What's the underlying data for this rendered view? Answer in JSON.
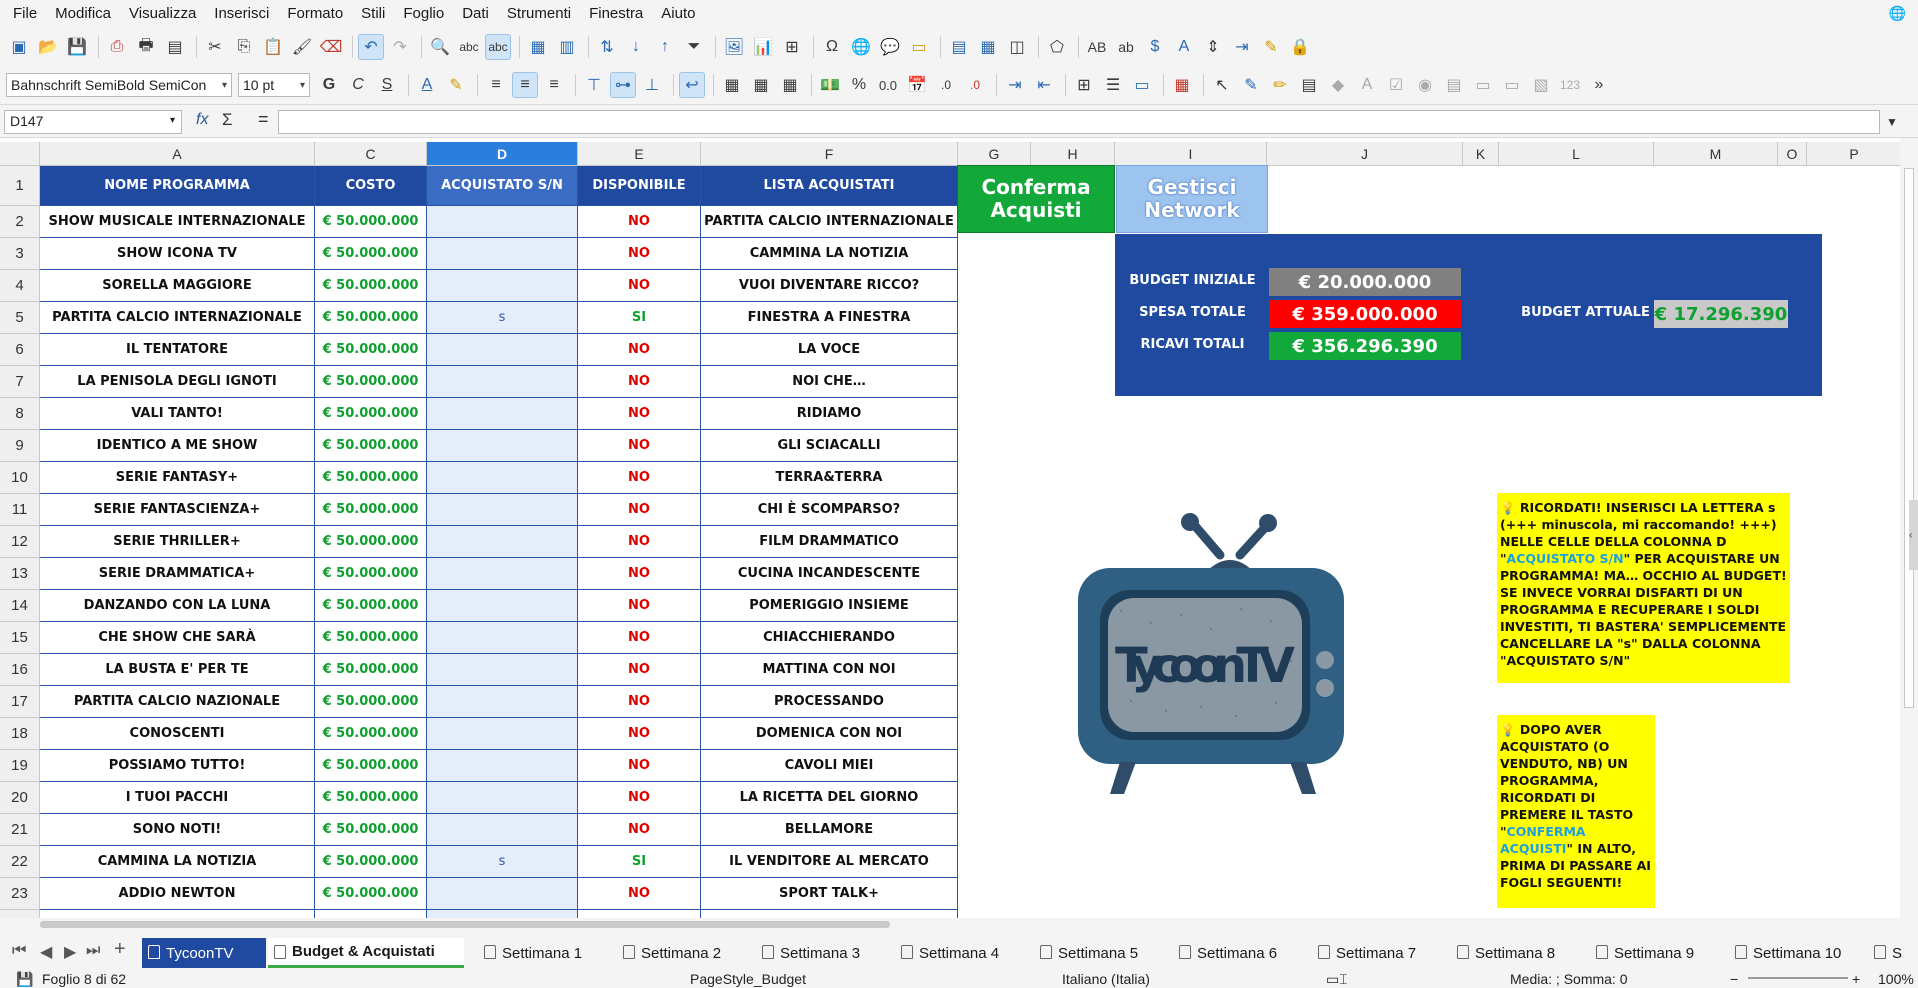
{
  "menubar": {
    "items": [
      "File",
      "Modifica",
      "Visualizza",
      "Inserisci",
      "Formato",
      "Stili",
      "Foglio",
      "Dati",
      "Strumenti",
      "Finestra",
      "Aiuto"
    ]
  },
  "toolbar": {
    "font_name": "Bahnschrift SemiBold SemiCon",
    "font_size": "10 pt",
    "bold": "G",
    "italic": "C",
    "underline": "S",
    "percent": "%",
    "decimal": "0.0"
  },
  "formula_bar": {
    "cell_ref": "D147",
    "fx": "fx",
    "sigma": "Σ",
    "equals": "=",
    "content": ""
  },
  "columns": [
    {
      "label": "A",
      "selected": false
    },
    {
      "label": "C",
      "selected": false
    },
    {
      "label": "D",
      "selected": true
    },
    {
      "label": "E",
      "selected": false
    },
    {
      "label": "F",
      "selected": false
    },
    {
      "label": "G",
      "selected": false
    },
    {
      "label": "H",
      "selected": false
    },
    {
      "label": "I",
      "selected": false
    },
    {
      "label": "J",
      "selected": false
    },
    {
      "label": "K",
      "selected": false
    },
    {
      "label": "L",
      "selected": false
    },
    {
      "label": "M",
      "selected": false
    },
    {
      "label": "O",
      "selected": false
    },
    {
      "label": "P",
      "selected": false
    }
  ],
  "table": {
    "headers": [
      "NOME PROGRAMMA",
      "COSTO",
      "ACQUISTATO S/N",
      "DISPONIBILE",
      "LISTA ACQUISTATI"
    ],
    "rows": [
      {
        "n": "2",
        "nome": "SHOW MUSICALE INTERNAZIONALE",
        "costo": "€ 50.000.000",
        "acq": "",
        "disp": "NO",
        "lista": "PARTITA CALCIO INTERNAZIONALE"
      },
      {
        "n": "3",
        "nome": "SHOW ICONA TV",
        "costo": "€ 50.000.000",
        "acq": "",
        "disp": "NO",
        "lista": "CAMMINA LA NOTIZIA"
      },
      {
        "n": "4",
        "nome": "SORELLA MAGGIORE",
        "costo": "€ 50.000.000",
        "acq": "",
        "disp": "NO",
        "lista": "VUOI DIVENTARE RICCO?"
      },
      {
        "n": "5",
        "nome": "PARTITA CALCIO INTERNAZIONALE",
        "costo": "€ 50.000.000",
        "acq": "s",
        "disp": "SI",
        "lista": "FINESTRA A FINESTRA"
      },
      {
        "n": "6",
        "nome": "IL TENTATORE",
        "costo": "€ 50.000.000",
        "acq": "",
        "disp": "NO",
        "lista": "LA VOCE"
      },
      {
        "n": "7",
        "nome": "LA PENISOLA DEGLI IGNOTI",
        "costo": "€ 50.000.000",
        "acq": "",
        "disp": "NO",
        "lista": "NOI CHE…"
      },
      {
        "n": "8",
        "nome": "VALI TANTO!",
        "costo": "€ 50.000.000",
        "acq": "",
        "disp": "NO",
        "lista": "RIDIAMO"
      },
      {
        "n": "9",
        "nome": "IDENTICO A ME SHOW",
        "costo": "€ 50.000.000",
        "acq": "",
        "disp": "NO",
        "lista": "GLI SCIACALLI"
      },
      {
        "n": "10",
        "nome": "SERIE FANTASY+",
        "costo": "€ 50.000.000",
        "acq": "",
        "disp": "NO",
        "lista": "TERRA&TERRA"
      },
      {
        "n": "11",
        "nome": "SERIE FANTASCIENZA+",
        "costo": "€ 50.000.000",
        "acq": "",
        "disp": "NO",
        "lista": "CHI È SCOMPARSO?"
      },
      {
        "n": "12",
        "nome": "SERIE THRILLER+",
        "costo": "€ 50.000.000",
        "acq": "",
        "disp": "NO",
        "lista": "FILM DRAMMATICO"
      },
      {
        "n": "13",
        "nome": "SERIE DRAMMATICA+",
        "costo": "€ 50.000.000",
        "acq": "",
        "disp": "NO",
        "lista": "CUCINA INCANDESCENTE"
      },
      {
        "n": "14",
        "nome": "DANZANDO CON LA LUNA",
        "costo": "€ 50.000.000",
        "acq": "",
        "disp": "NO",
        "lista": "POMERIGGIO INSIEME"
      },
      {
        "n": "15",
        "nome": "CHE SHOW CHE SARÀ",
        "costo": "€ 50.000.000",
        "acq": "",
        "disp": "NO",
        "lista": "CHIACCHIERANDO"
      },
      {
        "n": "16",
        "nome": "LA BUSTA E' PER TE",
        "costo": "€ 50.000.000",
        "acq": "",
        "disp": "NO",
        "lista": "MATTINA CON NOI"
      },
      {
        "n": "17",
        "nome": "PARTITA CALCIO NAZIONALE",
        "costo": "€ 50.000.000",
        "acq": "",
        "disp": "NO",
        "lista": "PROCESSANDO"
      },
      {
        "n": "18",
        "nome": "CONOSCENTI",
        "costo": "€ 50.000.000",
        "acq": "",
        "disp": "NO",
        "lista": "DOMENICA CON NOI"
      },
      {
        "n": "19",
        "nome": "POSSIAMO TUTTO!",
        "costo": "€ 50.000.000",
        "acq": "",
        "disp": "NO",
        "lista": "CAVOLI MIEI"
      },
      {
        "n": "20",
        "nome": "I TUOI PACCHI",
        "costo": "€ 50.000.000",
        "acq": "",
        "disp": "NO",
        "lista": "LA RICETTA DEL GIORNO"
      },
      {
        "n": "21",
        "nome": "SONO NOTI!",
        "costo": "€ 50.000.000",
        "acq": "",
        "disp": "NO",
        "lista": "BELLAMORE"
      },
      {
        "n": "22",
        "nome": "CAMMINA LA NOTIZIA",
        "costo": "€ 50.000.000",
        "acq": "s",
        "disp": "SI",
        "lista": "IL VENDITORE AL MERCATO"
      },
      {
        "n": "23",
        "nome": "ADDIO NEWTON",
        "costo": "€ 50.000.000",
        "acq": "",
        "disp": "NO",
        "lista": "SPORT TALK+"
      }
    ]
  },
  "buttons": {
    "conferma": "Conferma Acquisti",
    "gestisci": "Gestisci Network"
  },
  "budget": {
    "iniziale_label": "BUDGET INIZIALE",
    "iniziale_value": "€ 20.000.000",
    "spesa_label": "SPESA TOTALE",
    "spesa_value": "€ 359.000.000",
    "ricavi_label": "RICAVI TOTALI",
    "ricavi_value": "€ 356.296.390",
    "attuale_label": "BUDGET ATTUALE",
    "attuale_value": "€ 17.296.390"
  },
  "tv": {
    "logo": "TycoonTV"
  },
  "notes": {
    "note1_a": "💡 RICORDATI! INSERISCI LA LETTERA s (+++ minuscola, mi raccomando! +++) NELLE CELLE DELLA COLONNA D \"",
    "note1_hl": "ACQUISTATO S/N",
    "note1_b": "\" PER ACQUISTARE UN PROGRAMMA! MA… OCCHIO AL BUDGET! SE INVECE VORRAI DISFARTI DI UN PROGRAMMA E RECUPERARE I SOLDI INVESTITI, TI BASTERA' SEMPLICEMENTE CANCELLARE LA \"s\" DALLA COLONNA \"ACQUISTATO S/N\"",
    "note2_a": "💡 DOPO AVER ACQUISTATO (O VENDUTO, NB) UN PROGRAMMA, RICORDATI DI PREMERE IL TASTO \"",
    "note2_hl": "CONFERMA ACQUISTI",
    "note2_b": "\" IN ALTO, PRIMA DI PASSARE AI FOGLI SEGUENTI!"
  },
  "sheet_tabs": [
    {
      "label": "TycoonTV",
      "state": "tycoon"
    },
    {
      "label": "Budget & Acquistati",
      "state": "active"
    },
    {
      "label": "Settimana 1",
      "state": "normal"
    },
    {
      "label": "Settimana 2",
      "state": "normal"
    },
    {
      "label": "Settimana 3",
      "state": "normal"
    },
    {
      "label": "Settimana 4",
      "state": "normal"
    },
    {
      "label": "Settimana 5",
      "state": "normal"
    },
    {
      "label": "Settimana 6",
      "state": "normal"
    },
    {
      "label": "Settimana 7",
      "state": "normal"
    },
    {
      "label": "Settimana 8",
      "state": "normal"
    },
    {
      "label": "Settimana 9",
      "state": "normal"
    },
    {
      "label": "Settimana 10",
      "state": "normal"
    },
    {
      "label": "S",
      "state": "normal"
    }
  ],
  "statusbar": {
    "sheet": "Foglio 8 di 62",
    "page_style": "PageStyle_Budget",
    "language": "Italiano (Italia)",
    "summary": "Media: ; Somma: 0",
    "zoom": "100%"
  },
  "colors": {
    "header_blue": "#1f4aa0",
    "green": "#10a030",
    "red": "#e00000",
    "note_yellow": "#ffff00"
  }
}
